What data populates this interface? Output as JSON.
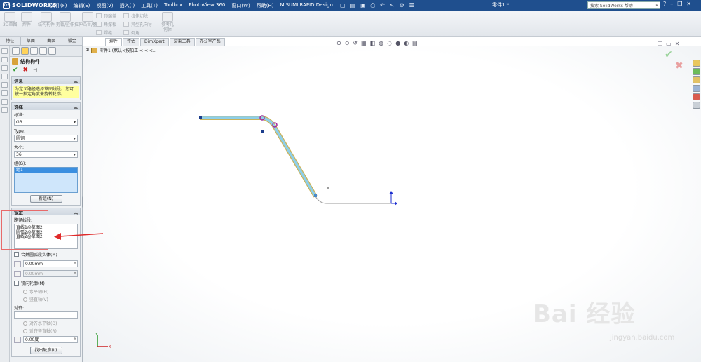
{
  "app": {
    "logo_text": "SOLIDWORKS",
    "doc_title": "零件1 *",
    "menus": [
      "文件(F)",
      "编辑(E)",
      "视图(V)",
      "插入(I)",
      "工具(T)",
      "Toolbox",
      "PhotoView 360",
      "窗口(W)",
      "帮助(H)",
      "MISUMI RAPID Design"
    ],
    "search_placeholder": "搜索 SolidWorks 帮助"
  },
  "toolbar": {
    "big": [
      "3D草图",
      "焊件",
      "结构构件",
      "剪裁/延伸",
      "拉伸凸台/基体"
    ],
    "small": [
      "顶端盖",
      "角撑板",
      "焊缝",
      "拉伸切除",
      "异型孔向导",
      "倒角"
    ],
    "ref_geometry": "参考几何体"
  },
  "command_tabs": [
    "特征",
    "草图",
    "曲面",
    "钣金"
  ],
  "command_tabs2": [
    "焊件",
    "评估",
    "DimXpert",
    "渲染工具",
    "办公室产品"
  ],
  "tree_label": "零件1 (默认<按加工 < < <...",
  "property_manager": {
    "title": "结构构件",
    "info_header": "信息",
    "info_text": "为定义路径选择草图线段。您可按一指定角度来旋转轮廓。",
    "selection_header": "选择",
    "standard_label": "标准:",
    "standard_value": "GB",
    "type_label": "Type：",
    "type_value": "圆钢",
    "size_label": "大小:",
    "size_value": "36",
    "group_label": "组(G):",
    "group_item": "组1",
    "new_group_btn": "新组(N)",
    "settings_header": "设定",
    "path_label": "路径线段:",
    "path_items": [
      "直线1@草图2",
      "圆弧2@草图2",
      "直线2@草图2"
    ],
    "merge_arc": "合并圆弧段实体(M)",
    "offset1": "0.00mm",
    "offset2": "0.00mm",
    "mirror_profile": "镜向轮廓(M)",
    "horizontal_axis": "水平轴(H)",
    "vertical_axis": "竖直轴(V)",
    "align_label": "对齐:",
    "align_horizontal": "对齐水平轴(O)",
    "align_vertical": "对齐竖直轴(R)",
    "angle_value": "0.00度",
    "locate_profile_btn": "找出轮廓(L)"
  },
  "watermark": {
    "text": "Bai 经验",
    "url": "jingyan.baidu.com"
  },
  "colors": {
    "menubar": "#1f4f8e",
    "path_fill": "#8ecfe9",
    "path_stroke": "#c9b25a",
    "highlight_red": "#e02a2a"
  }
}
